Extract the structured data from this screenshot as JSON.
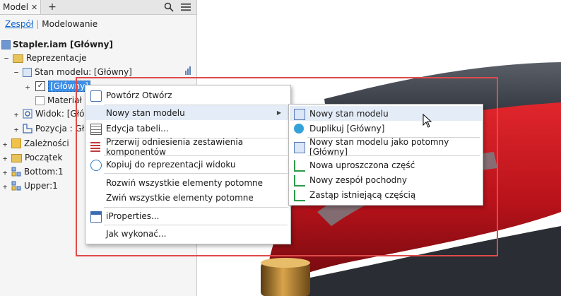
{
  "panel": {
    "tab_label": "Model",
    "tab_close": "✕",
    "add_tab": "+",
    "subtab_active": "Zespół",
    "subtab_other": "Modelowanie"
  },
  "tree": {
    "root": "Stapler.iam [Główny]",
    "representations": "Reprezentacje",
    "model_state": "Stan modelu: [Główny]",
    "main_state": "[Główny]",
    "material": "Materiał",
    "view": "Widok: [Głó",
    "position": "Pozycja :  Gł",
    "relationships": "Zależności",
    "origin": "Początek",
    "bottom": "Bottom:1",
    "upper": "Upper:1"
  },
  "context_menu": {
    "items": [
      "Powtórz Otwórz",
      "Nowy stan modelu",
      "Edycja tabeli...",
      "Przerwij odniesienia zestawienia komponentów",
      "Kopiuj do reprezentacji widoku",
      "Rozwiń wszystkie elementy potomne",
      "Zwiń wszystkie elementy potomne",
      "iProperties...",
      "Jak wykonać..."
    ]
  },
  "submenu": {
    "items": [
      "Nowy stan modelu",
      "Duplikuj [Główny]",
      "Nowy stan modelu jako potomny [Główny]",
      "Nowa uproszczona część",
      "Nowy zespół pochodny",
      "Zastąp istniejącą częścią"
    ]
  },
  "colors": {
    "selection": "#3d8ee6",
    "highlight_box": "#e04a4a",
    "menu_hover": "#e4ecf7",
    "stapler_red": "#c4161c"
  }
}
